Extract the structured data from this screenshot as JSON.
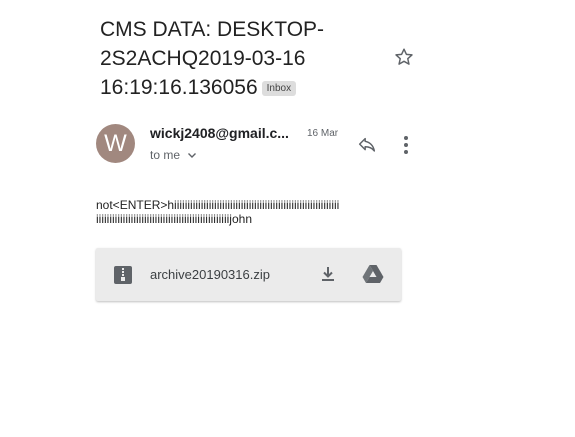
{
  "email": {
    "subject": "CMS DATA: DESKTOP-2S2ACHQ2019-03-16 16:19:16.136056",
    "label": "Inbox",
    "sender": {
      "avatar_letter": "W",
      "avatar_color": "#a1887f",
      "address": "wickj2408@gmail.c...",
      "date": "16 Mar",
      "recipient": "to me"
    },
    "body": "not<ENTER>hiiiiiiiiiiiiiiiiiiiiiiiiiiiiiiiiiiiiiiiiiiiiiiiiiiiiiiiiiiiiiiiiiiiiiiiiiiiiiiiiiiiiiiiiiiiiiiiiiiiiiiiiiiiiiiiijohn",
    "attachment": {
      "filename": "archive20190316.zip",
      "icon": "zip-file-icon"
    }
  },
  "icons": {
    "star": "star-outline-icon",
    "reply": "reply-icon",
    "more": "more-vert-icon",
    "download": "download-icon",
    "drive": "google-drive-icon"
  }
}
